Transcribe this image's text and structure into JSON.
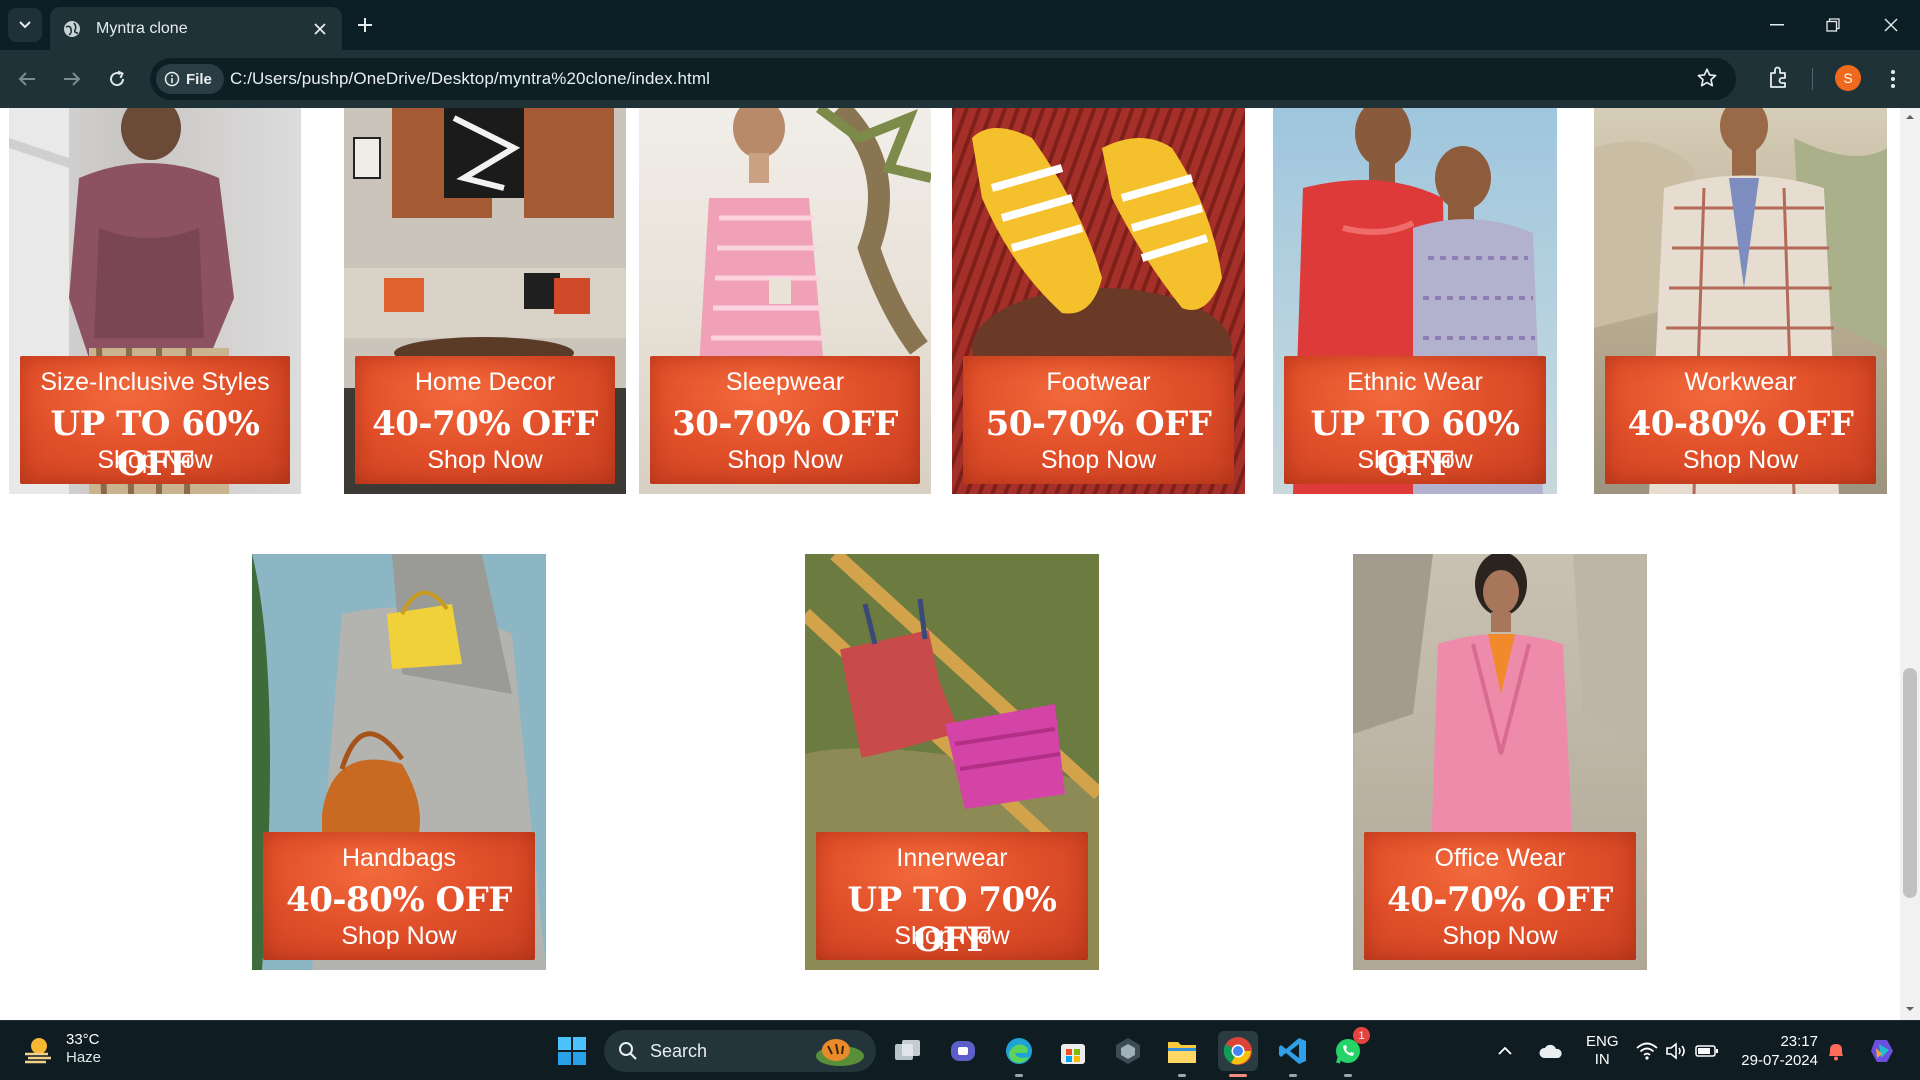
{
  "browser": {
    "tab_title": "Myntra clone",
    "file_chip": "File",
    "url": "C:/Users/pushp/OneDrive/Desktop/myntra%20clone/index.html",
    "profile_initial": "S"
  },
  "page": {
    "row1": [
      {
        "category": "Size-Inclusive Styles",
        "offer": "UP TO 60% OFF",
        "cta": "Shop Now"
      },
      {
        "category": "Home Decor",
        "offer": "40-70% OFF",
        "cta": "Shop Now"
      },
      {
        "category": "Sleepwear",
        "offer": "30-70% OFF",
        "cta": "Shop Now"
      },
      {
        "category": "Footwear",
        "offer": "50-70% OFF",
        "cta": "Shop Now"
      },
      {
        "category": "Ethnic Wear",
        "offer": "UP TO 60% OFF",
        "cta": "Shop Now"
      },
      {
        "category": "Workwear",
        "offer": "40-80% OFF",
        "cta": "Shop Now"
      }
    ],
    "row2": [
      {
        "category": "Handbags",
        "offer": "40-80% OFF",
        "cta": "Shop Now"
      },
      {
        "category": "Innerwear",
        "offer": "UP TO 70% OFF",
        "cta": "Shop Now"
      },
      {
        "category": "Office Wear",
        "offer": "40-70% OFF",
        "cta": "Shop Now"
      }
    ]
  },
  "taskbar": {
    "weather_temp": "33°C",
    "weather_condition": "Haze",
    "search_label": "Search",
    "whatsapp_badge": "1",
    "lang_top": "ENG",
    "lang_bottom": "IN",
    "time": "23:17",
    "date": "29-07-2024"
  },
  "colors": {
    "banner_orange": "#e2502a",
    "chrome_dark": "#0c1e25",
    "toolbar": "#1f3238",
    "avatar": "#f06a1d"
  }
}
